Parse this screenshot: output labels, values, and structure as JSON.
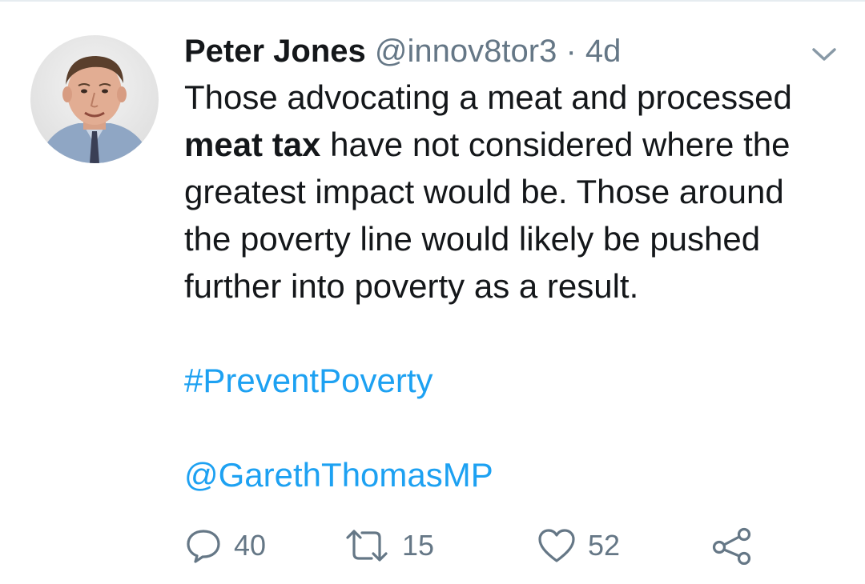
{
  "tweet": {
    "author_name": "Peter Jones",
    "handle": "@innov8tor3",
    "separator": "·",
    "age": "4d",
    "body_lines": [
      [
        "Those advocating a meat and processed"
      ],
      [
        "meat tax",
        " have not considered where the"
      ],
      [
        "greatest impact would be. Those around"
      ],
      [
        "the poverty line would likely be pushed"
      ],
      [
        "further into poverty as a result."
      ]
    ],
    "body": {
      "line1": "Those advocating a meat and processed",
      "line2_bold": "meat tax",
      "line2_rest": " have not considered where the",
      "line3": "greatest impact would be. Those around",
      "line4": "the poverty line would likely be pushed",
      "line5": "further into poverty as a result."
    },
    "hashtag": "#PreventPoverty",
    "mention": "@GarethThomasMP",
    "stats": {
      "replies": "40",
      "retweets": "15",
      "likes": "52"
    }
  },
  "icons": {
    "caret": "chevron-down-icon",
    "reply": "reply-icon",
    "retweet": "retweet-icon",
    "like": "heart-icon",
    "share": "share-icon"
  },
  "colors": {
    "link": "#1da1f2",
    "muted": "#657786",
    "text": "#14171a"
  }
}
